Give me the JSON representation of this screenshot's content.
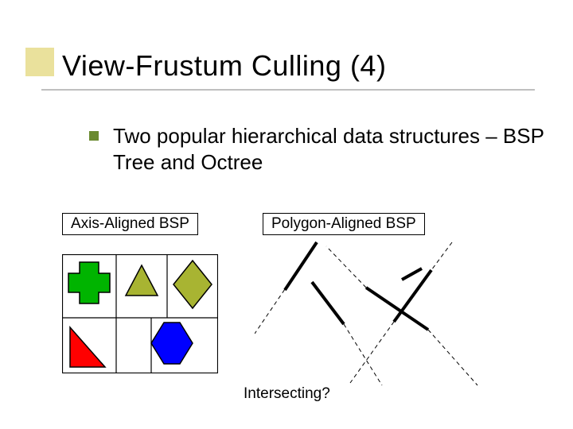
{
  "title": "View-Frustum Culling (4)",
  "bullet": "Two popular hierarchical data structures – BSP Tree and Octree",
  "labels": {
    "axis": "Axis-Aligned BSP",
    "poly": "Polygon-Aligned BSP"
  },
  "caption": "Intersecting?",
  "colors": {
    "accent": "#d9c94a",
    "bullet": "#6a8a2f",
    "green_shape": "#00b400",
    "olive_shape": "#a8b432",
    "blue_shape": "#0000ff",
    "red_shape": "#ff0000"
  }
}
